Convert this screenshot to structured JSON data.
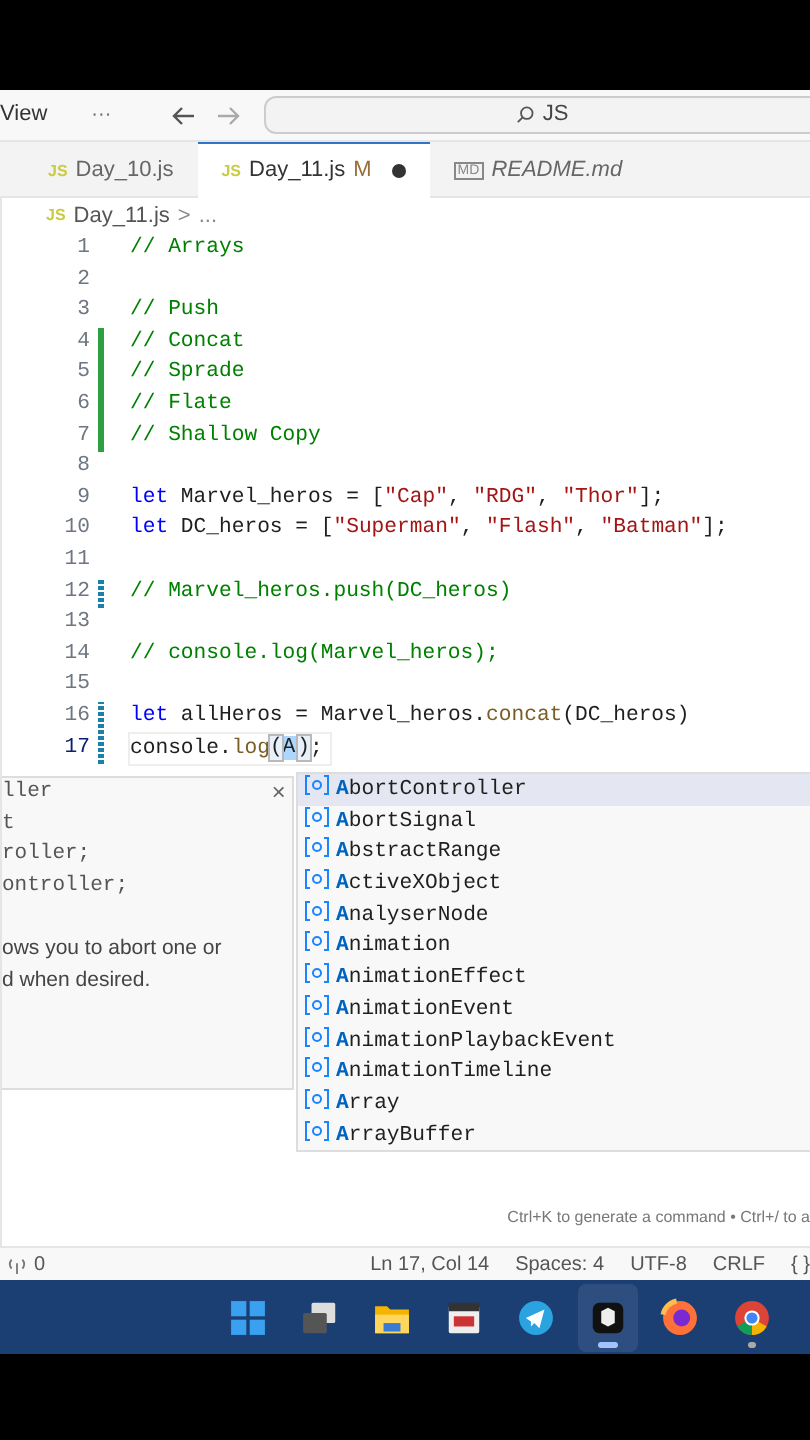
{
  "title_bar": {
    "menu": "View",
    "more": "···",
    "search": {
      "value": "JS"
    }
  },
  "tabs": [
    {
      "label": "Day_10.js",
      "lang": "JS",
      "selected": false,
      "preview": false
    },
    {
      "label": "Day_11.js",
      "lang": "JS",
      "selected": true,
      "preview": false,
      "status": "M",
      "dirty": true
    },
    {
      "label": "README.md",
      "lang": "MD",
      "selected": false,
      "preview": true
    }
  ],
  "breadcrumb": {
    "lang": "JS",
    "file": "Day_11.js",
    "sep": ">",
    "more": "..."
  },
  "editor": {
    "lines": [
      {
        "n": "1",
        "tokens": [
          {
            "kind": "comment",
            "t": "// Arrays"
          }
        ]
      },
      {
        "n": "2"
      },
      {
        "n": "3",
        "tokens": [
          {
            "kind": "comment",
            "t": "// Push"
          }
        ]
      },
      {
        "n": "4",
        "added": true,
        "tokens": [
          {
            "kind": "comment",
            "t": "// Concat"
          }
        ]
      },
      {
        "n": "5",
        "added": true,
        "tokens": [
          {
            "kind": "comment",
            "t": "// Sprade"
          }
        ]
      },
      {
        "n": "6",
        "added": true,
        "tokens": [
          {
            "kind": "comment",
            "t": "// Flate"
          }
        ]
      },
      {
        "n": "7",
        "added": true,
        "tokens": [
          {
            "kind": "comment",
            "t": "// Shallow Copy"
          }
        ]
      },
      {
        "n": "8"
      },
      {
        "n": "9",
        "tokens": [
          {
            "kind": "keyword",
            "t": "let"
          },
          {
            "kind": "plain",
            "t": " Marvel_heros = ["
          },
          {
            "kind": "string",
            "t": "\"Cap\""
          },
          {
            "kind": "plain",
            "t": ", "
          },
          {
            "kind": "string",
            "t": "\"RDG\""
          },
          {
            "kind": "plain",
            "t": ", "
          },
          {
            "kind": "string",
            "t": "\"Thor\""
          },
          {
            "kind": "plain",
            "t": "];"
          }
        ]
      },
      {
        "n": "10",
        "tokens": [
          {
            "kind": "keyword",
            "t": "let"
          },
          {
            "kind": "plain",
            "t": " DC_heros = ["
          },
          {
            "kind": "string",
            "t": "\"Superman\""
          },
          {
            "kind": "plain",
            "t": ", "
          },
          {
            "kind": "string",
            "t": "\"Flash\""
          },
          {
            "kind": "plain",
            "t": ", "
          },
          {
            "kind": "string",
            "t": "\"Batman\""
          },
          {
            "kind": "plain",
            "t": "];"
          }
        ]
      },
      {
        "n": "11"
      },
      {
        "n": "12",
        "modified": true,
        "tokens": [
          {
            "kind": "comment",
            "t": "// Marvel_heros.push(DC_heros)"
          }
        ]
      },
      {
        "n": "13"
      },
      {
        "n": "14",
        "tokens": [
          {
            "kind": "comment",
            "t": "// console.log(Marvel_heros);"
          }
        ]
      },
      {
        "n": "15"
      },
      {
        "n": "16",
        "modified": true,
        "tokens": [
          {
            "kind": "keyword",
            "t": "let"
          },
          {
            "kind": "plain",
            "t": " allHeros = Marvel_heros."
          },
          {
            "kind": "method",
            "t": "concat"
          },
          {
            "kind": "plain",
            "t": "(DC_heros)"
          }
        ]
      },
      {
        "n": "17",
        "modified": true,
        "current": true,
        "tokens": [
          {
            "kind": "plain",
            "t": "console."
          },
          {
            "kind": "method",
            "t": "log"
          },
          {
            "kind": "bracket",
            "t": "("
          },
          {
            "kind": "typed",
            "t": "A"
          },
          {
            "kind": "bracket",
            "t": ")"
          },
          {
            "kind": "plain",
            "t": ";"
          }
        ]
      }
    ],
    "hover": {
      "close": "×",
      "code_lines": [
        "ller",
        "t",
        "roller;",
        "ontroller;"
      ],
      "description_lines": [
        "ows you to abort one or",
        "d when desired."
      ]
    },
    "suggestions": [
      {
        "label": "**A**bortController",
        "selected": true
      },
      {
        "label": "**A**bortSignal",
        "selected": false
      },
      {
        "label": "**A**bstractRange",
        "selected": false
      },
      {
        "label": "**A**ctiveXObject",
        "selected": false
      },
      {
        "label": "**A**nalyserNode",
        "selected": false
      },
      {
        "label": "**A**nimation",
        "selected": false
      },
      {
        "label": "**A**nimationEffect",
        "selected": false
      },
      {
        "label": "**A**nimationEvent",
        "selected": false
      },
      {
        "label": "**A**nimationPlaybackEvent",
        "selected": false
      },
      {
        "label": "**A**nimationTimeline",
        "selected": false
      },
      {
        "label": "**A**rray",
        "selected": false
      },
      {
        "label": "**A**rrayBuffer",
        "selected": false
      }
    ],
    "hint": "Ctrl+K to generate a command • Ctrl+/ to a"
  },
  "status_bar": {
    "ports": "0",
    "items": [
      "Ln 17, Col 14",
      "Spaces: 4",
      "UTF-8",
      "CRLF",
      "{ }"
    ]
  },
  "taskbar": [
    {
      "kind": "start",
      "selected": false,
      "running": false
    },
    {
      "kind": "taskview",
      "selected": false,
      "running": false
    },
    {
      "kind": "folder",
      "selected": false,
      "running": false
    },
    {
      "kind": "media",
      "selected": false,
      "running": false
    },
    {
      "kind": "telegram",
      "selected": false,
      "running": false
    },
    {
      "kind": "cube",
      "selected": true,
      "running": true
    },
    {
      "kind": "firefox",
      "selected": false,
      "running": false
    },
    {
      "kind": "chrome",
      "selected": false,
      "running": true
    }
  ]
}
